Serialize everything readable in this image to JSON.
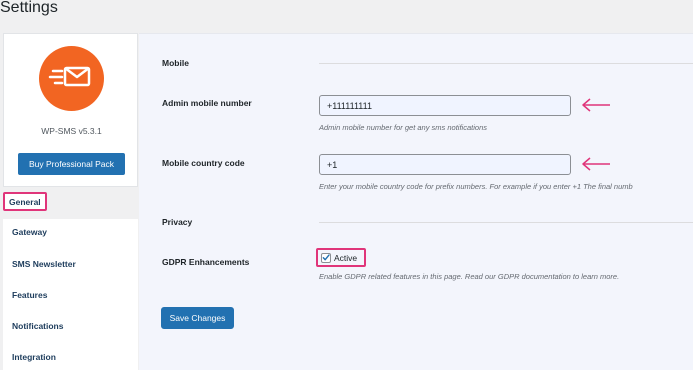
{
  "page": {
    "title": "Settings"
  },
  "sidebar": {
    "logo_icon": "envelope-send-icon",
    "brand_color": "#f26522",
    "version": "WP-SMS v5.3.1",
    "buy_label": "Buy Professional Pack",
    "tabs": [
      {
        "label": "General",
        "active": true
      },
      {
        "label": "Gateway"
      },
      {
        "label": "SMS Newsletter"
      },
      {
        "label": "Features"
      },
      {
        "label": "Notifications"
      },
      {
        "label": "Integration"
      }
    ]
  },
  "form": {
    "section_mobile": "Mobile",
    "admin_mobile": {
      "label": "Admin mobile number",
      "value": "+111111111",
      "description": "Admin mobile number for get any sms notifications"
    },
    "country_code": {
      "label": "Mobile country code",
      "value": "+1",
      "description": "Enter your mobile country code for prefix numbers. For example if you enter +1 The final numb"
    },
    "section_privacy": "Privacy",
    "gdpr": {
      "label": "GDPR Enhancements",
      "checkbox_label": "Active",
      "checked": true,
      "description": "Enable GDPR related features in this page. Read our GDPR documentation to learn more."
    },
    "save_label": "Save Changes"
  },
  "colors": {
    "accent": "#2271b1",
    "highlight": "#e0357a"
  }
}
